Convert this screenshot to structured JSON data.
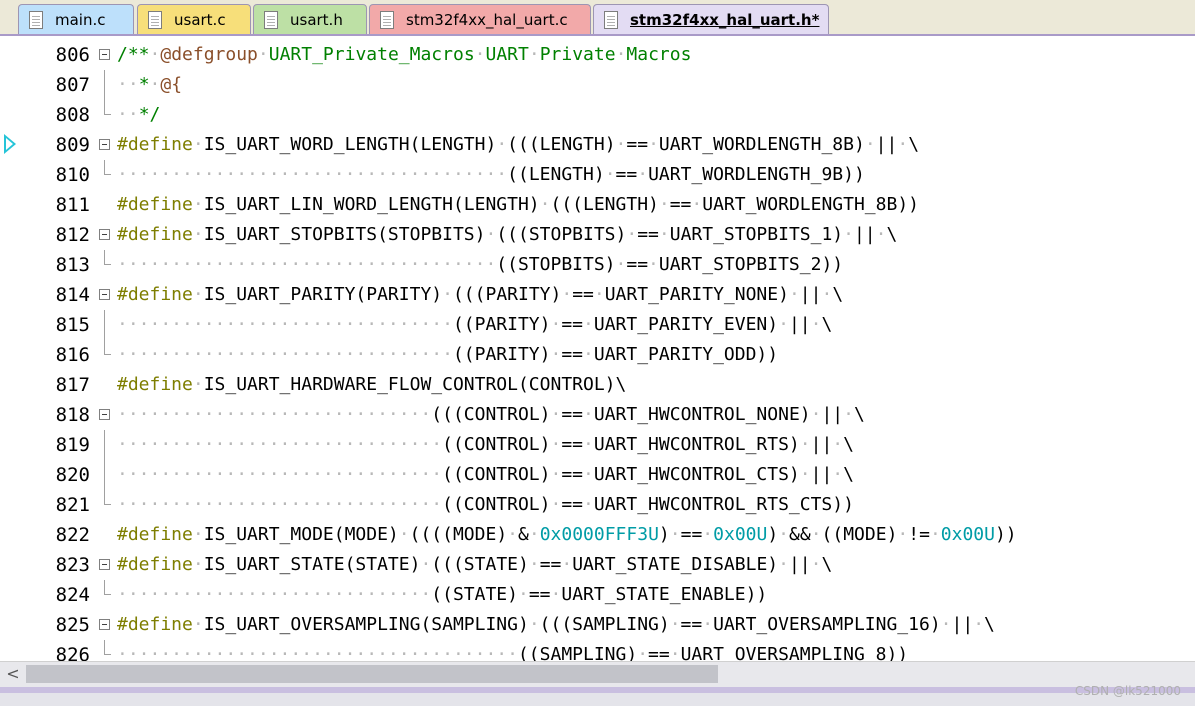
{
  "tabs": [
    {
      "label": "main.c",
      "color": "#bde0fb"
    },
    {
      "label": "usart.c",
      "color": "#f7df7a"
    },
    {
      "label": "usart.h",
      "color": "#bde0a5"
    },
    {
      "label": "stm32f4xx_hal_uart.c",
      "color": "#f2a9a9"
    },
    {
      "label": "stm32f4xx_hal_uart.h*",
      "color": "#e3dcf3"
    }
  ],
  "active_tab": "stm32f4xx_hal_uart.h*",
  "editor": {
    "line_numbers": [
      "806",
      "807",
      "808",
      "809",
      "810",
      "811",
      "812",
      "813",
      "814",
      "815",
      "816",
      "817",
      "818",
      "819",
      "820",
      "821",
      "822",
      "823",
      "824",
      "825",
      "826"
    ],
    "bookmark_line": "809"
  },
  "scrollbar": {
    "left_arrow": "<"
  },
  "watermark": "CSDN @lk521000"
}
